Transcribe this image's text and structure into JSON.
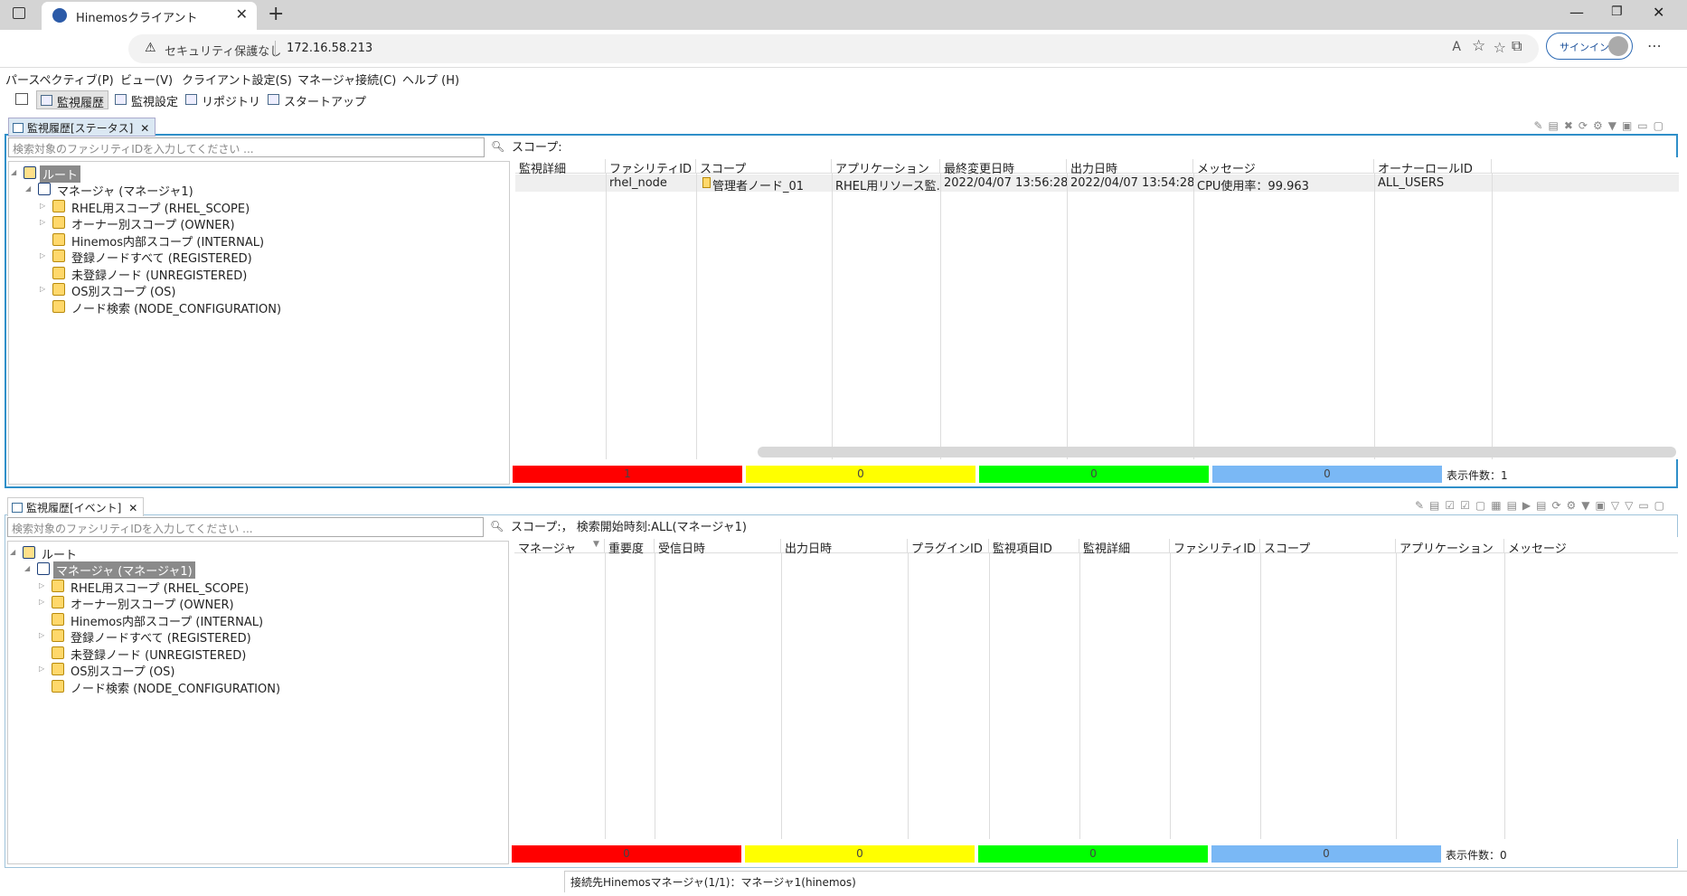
{
  "browser": {
    "tab_title": "Hinemosクライアント",
    "security": "セキュリティ保護なし",
    "address": "172.16.58.213",
    "signin": "サインイン"
  },
  "menu": [
    "パースペクティブ(P)",
    "ビュー(V)",
    "クライアント設定(S)",
    "マネージャ接続(C)",
    "ヘルプ (H)"
  ],
  "perspectives": [
    "監視履歴",
    "監視設定",
    "リポジトリ",
    "スタートアップ"
  ],
  "status_view": {
    "tab": "監視履歴[ステータス]",
    "search_placeholder": "検索対象のファシリティIDを入力してください ...",
    "scope_label": "スコープ:",
    "tree": {
      "root": "ルート",
      "manager": "マネージャ (マネージャ1)",
      "items": [
        "RHEL用スコープ (RHEL_SCOPE)",
        "オーナー別スコープ (OWNER)",
        "Hinemos内部スコープ (INTERNAL)",
        "登録ノードすべて (REGISTERED)",
        "未登録ノード (UNREGISTERED)",
        "OS別スコープ (OS)",
        "ノード検索 (NODE_CONFIGURATION)"
      ]
    },
    "columns": [
      "監視詳細",
      "ファシリティID",
      "スコープ",
      "アプリケーション",
      "最終変更日時",
      "出力日時",
      "メッセージ",
      "オーナーロールID"
    ],
    "rows": [
      [
        "",
        "rhel_node",
        "管理者ノード_01",
        "RHEL用リソース監...",
        "2022/04/07 13:56:28",
        "2022/04/07 13:54:28",
        "CPU使用率：99.963",
        "ALL_USERS"
      ]
    ],
    "summary": [
      "1",
      "0",
      "0",
      "0"
    ],
    "count": "表示件数：1"
  },
  "event_view": {
    "tab": "監視履歴[イベント]",
    "search_placeholder": "検索対象のファシリティIDを入力してください ...",
    "scope_label": "スコープ:，  検索開始時刻:ALL(マネージャ1)",
    "tree": {
      "root": "ルート",
      "manager": "マネージャ (マネージャ1)",
      "items": [
        "RHEL用スコープ (RHEL_SCOPE)",
        "オーナー別スコープ (OWNER)",
        "Hinemos内部スコープ (INTERNAL)",
        "登録ノードすべて (REGISTERED)",
        "未登録ノード (UNREGISTERED)",
        "OS別スコープ (OS)",
        "ノード検索 (NODE_CONFIGURATION)"
      ]
    },
    "columns": [
      "マネージャ",
      "重要度",
      "受信日時",
      "出力日時",
      "プラグインID",
      "監視項目ID",
      "監視詳細",
      "ファシリティID",
      "スコープ",
      "アプリケーション",
      "メッセージ"
    ],
    "summary": [
      "0",
      "0",
      "0",
      "0"
    ],
    "count": "表示件数：0"
  },
  "status_bar": "接続先Hinemosマネージャ(1/1)：マネージャ1(hinemos)",
  "colors": {
    "critical": "#ff0000",
    "warning": "#ffff00",
    "info": "#00ff00",
    "unknown": "#7ab8f5"
  }
}
